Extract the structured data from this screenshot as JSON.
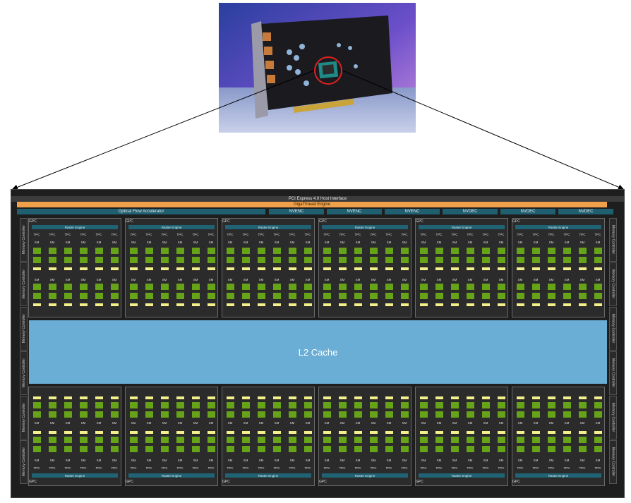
{
  "die": {
    "host_interface": "PCI Express 4.0 Host Interface",
    "gigathread": "GigaThread Engine",
    "optical_flow": "Optical Flow Accelerator",
    "engines": [
      "NVENC",
      "NVENC",
      "NVENC",
      "NVDEC",
      "NVDEC",
      "NVDEC"
    ],
    "l2_cache": "L2 Cache",
    "memory_controller": "Memory Controller",
    "gpc": {
      "label": "GPC",
      "raster_engine": "Raster Engine",
      "tpc": "TPC",
      "sm": "SM"
    },
    "gpc_count": 12,
    "memory_controllers_per_side": 6
  },
  "colors": {
    "die_background": "#1e1e1e",
    "gigathread": "#f0a04b",
    "engine_blue": "#1f5f70",
    "l2_cache": "#6aaed6",
    "sm_core": "#66a318",
    "sm_highlight": "#f3f08c"
  }
}
